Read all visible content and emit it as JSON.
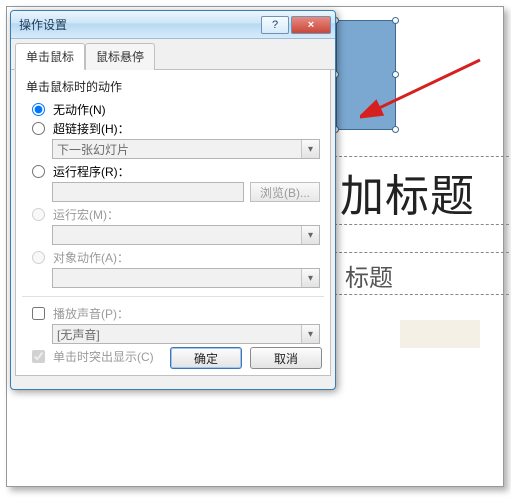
{
  "dialog": {
    "title": "操作设置",
    "help_label": "?",
    "close_label": "×",
    "tabs": {
      "click": "单击鼠标",
      "hover": "鼠标悬停"
    },
    "group_title": "单击鼠标时的动作",
    "radios": {
      "none": "无动作(N)",
      "hyperlink": "超链接到(H)：",
      "run_program": "运行程序(R)：",
      "run_macro": "运行宏(M)：",
      "object_action": "对象动作(A)："
    },
    "combos": {
      "hyperlink_value": "下一张幻灯片",
      "program_value": "",
      "macro_value": "",
      "object_value": "",
      "sound_value": "[无声音]"
    },
    "browse": "浏览(B)...",
    "checks": {
      "play_sound": "播放声音(P)：",
      "highlight": "单击时突出显示(C)"
    },
    "buttons": {
      "ok": "确定",
      "cancel": "取消"
    }
  },
  "slide": {
    "title": "加标题",
    "subtitle": "标题"
  }
}
